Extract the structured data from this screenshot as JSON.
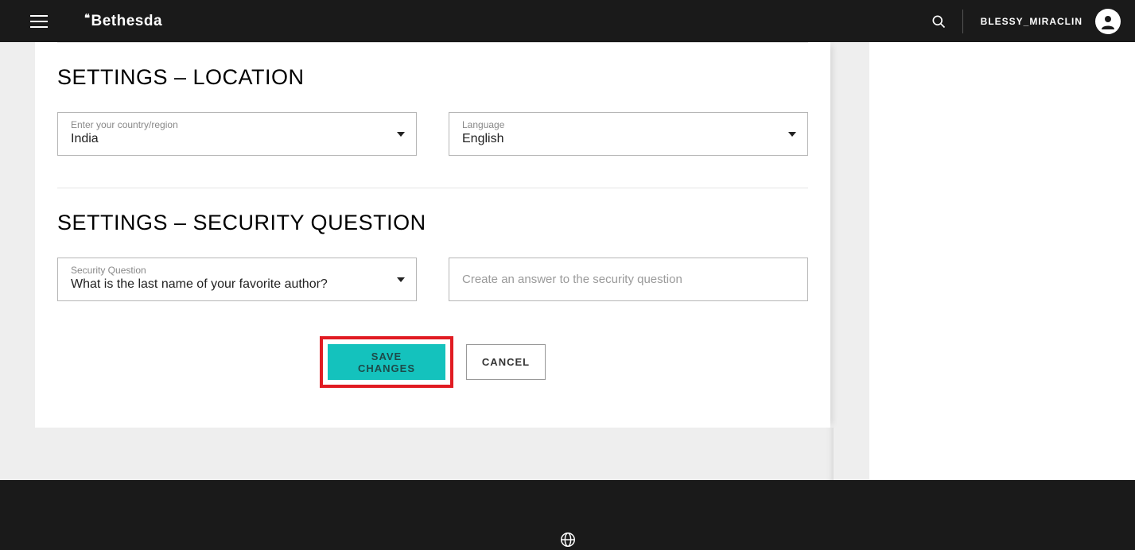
{
  "header": {
    "brand": "Bethesda",
    "username": "BLESSY_MIRACLIN"
  },
  "sections": {
    "location": {
      "title": "SETTINGS – LOCATION",
      "country": {
        "label": "Enter your country/region",
        "value": "India"
      },
      "language": {
        "label": "Language",
        "value": "English"
      }
    },
    "security": {
      "title": "SETTINGS – SECURITY QUESTION",
      "question": {
        "label": "Security Question",
        "value": "What is the last name of your favorite author?"
      },
      "answer_placeholder": "Create an answer to the security question"
    }
  },
  "actions": {
    "save": "SAVE CHANGES",
    "cancel": "CANCEL"
  }
}
